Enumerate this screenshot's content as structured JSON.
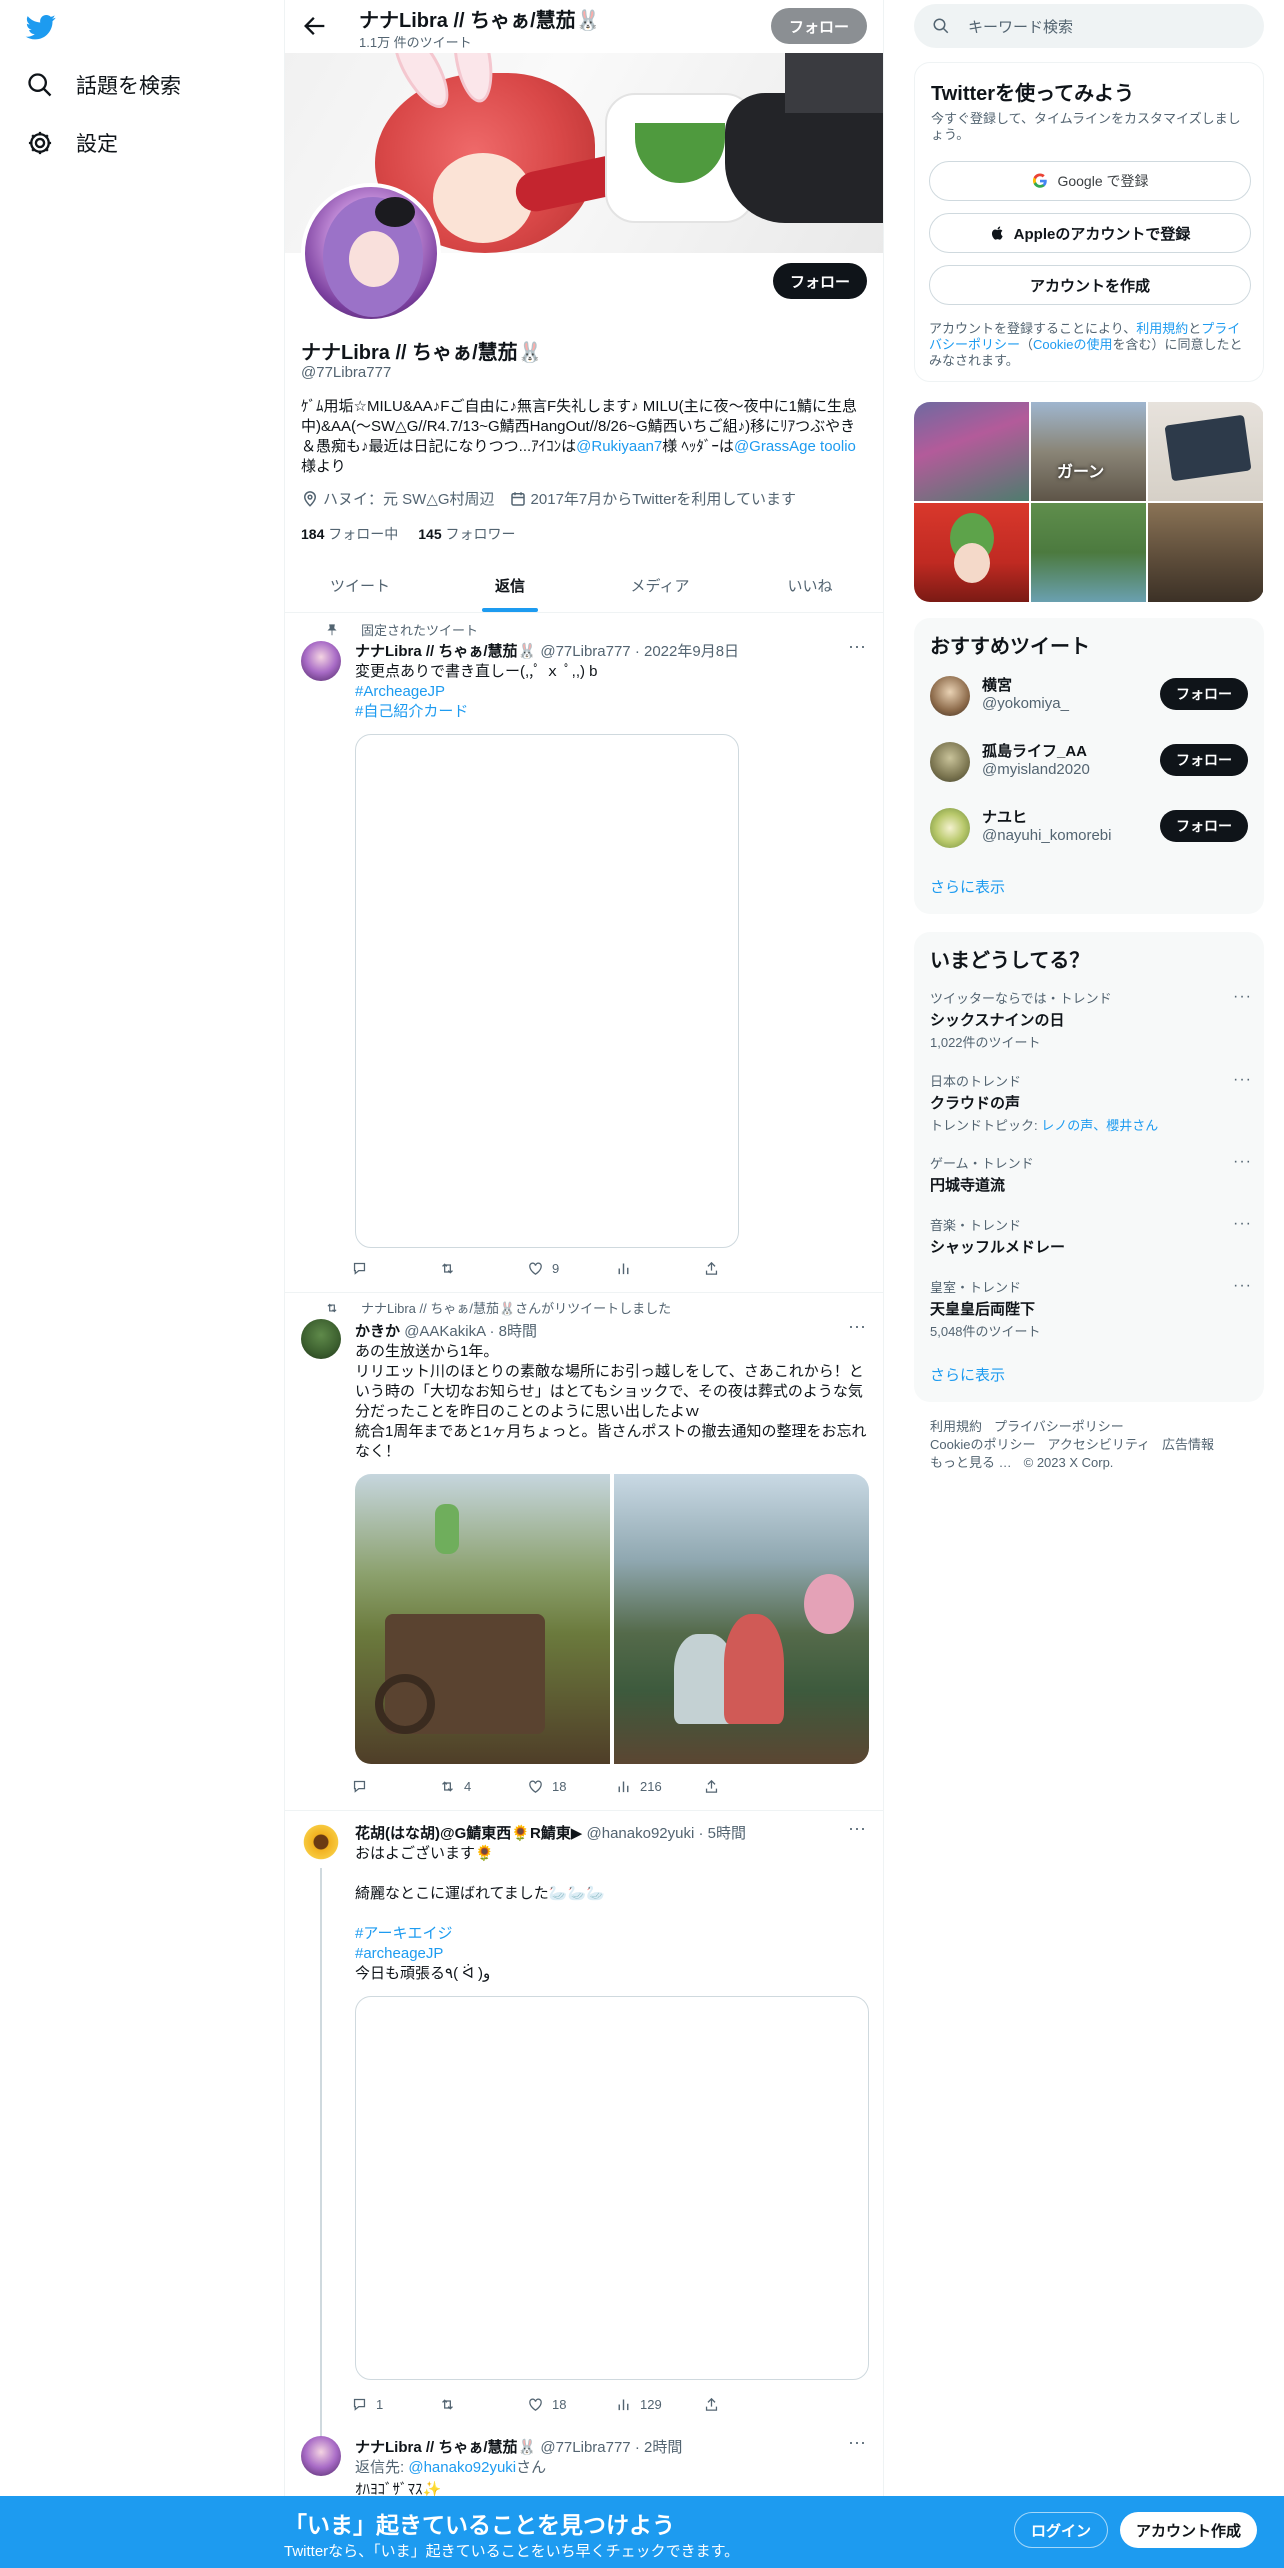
{
  "nav": {
    "explore_label": "話題を検索",
    "settings_label": "設定"
  },
  "header": {
    "name": "ナナLibra // ちゃぁ/慧茄🐰",
    "tweet_count": "1.1万 件のツイート",
    "follow_label": "フォロー"
  },
  "profile": {
    "follow_label": "フォロー",
    "name": "ナナLibra // ちゃぁ/慧茄🐰",
    "handle": "@77Libra777",
    "bio_text": "ｹﾞﾑ用垢☆MILU&AA♪Fご自由に♪無言F失礼します♪ MILU(主に夜〜夜中に1鯖に生息中)&AA(〜SW△G//R4.7/13~G鯖西HangOut//8/26~G鯖西いちご組♪)移にﾘｱつぶやき＆愚痴も♪最近は日記になりつつ...ｱｲｺﾝは",
    "bio_link1": "@Rukiyaan7",
    "bio_mid": "様 ﾍｯﾀﾞｰは",
    "bio_link2": "@GrassAge toolio",
    "bio_end": "様より",
    "location": "ハヌイ：元 SW△G村周辺",
    "joined": "2017年7月からTwitterを利用しています",
    "following_count": "184",
    "following_label": "フォロー中",
    "followers_count": "145",
    "followers_label": "フォロワー"
  },
  "tabs": [
    {
      "label": "ツイート"
    },
    {
      "label": "返信"
    },
    {
      "label": "メディア"
    },
    {
      "label": "いいね"
    }
  ],
  "tweets": [
    {
      "context": "固定されたツイート",
      "name": "ナナLibra // ちゃぁ/慧茄🐰",
      "handle": "@77Libra777",
      "time": "2022年9月8日",
      "text": "変更点ありで書き直しー(,,ﾟ ｘ ﾟ,,) b",
      "tag1": "#ArcheageJP",
      "tag2": "#自己紹介カード",
      "likes": "9"
    },
    {
      "context": "ナナLibra // ちゃぁ/慧茄🐰さんがリツイートしました",
      "name": "かきか",
      "handle": "@AAKakikA",
      "time": "8時間",
      "text": "あの生放送から1年。\nリリエット川のほとりの素敵な場所にお引っ越しをして、さあこれから！という時の「大切なお知らせ」はとてもショックで、その夜は葬式のような気分だったことを昨日のことのように思い出したよｗ\n統合1周年まであと1ヶ月ちょっと。皆さんポストの撤去通知の整理をお忘れなく！",
      "retweets": "4",
      "likes": "18",
      "views": "216"
    },
    {
      "name": "花胡(はな胡)@G鯖東西🌻R鯖東▶",
      "handle": "@hanako92yuki",
      "time": "5時間",
      "line1": "おはよございます🌻",
      "line2": "綺麗なとこに運ばれてました🦢🦢🦢",
      "tag1": "#アーキエイジ",
      "tag2": "#archeageJP",
      "line3": "今日も頑張る٩( ᐛ )و",
      "replies": "1",
      "likes": "18",
      "views": "129"
    },
    {
      "name": "ナナLibra // ちゃぁ/慧茄🐰",
      "handle": "@77Libra777",
      "time": "2時間",
      "reply_prefix": "返信先:",
      "reply_to": "@hanako92yuki",
      "reply_suffix": "さん",
      "text": "ｵﾊﾖｺﾞｻﾞﾏｽ✨"
    }
  ],
  "search": {
    "placeholder": "キーワード検索"
  },
  "signup": {
    "title": "Twitterを使ってみよう",
    "subtitle": "今すぐ登録して、タイムラインをカスタマイズしましょう。",
    "google": "Google で登録",
    "apple": "Appleのアカウントで登録",
    "create": "アカウントを作成",
    "legal_a": "アカウントを登録することにより、",
    "legal_terms": "利用規約",
    "legal_and": "と",
    "legal_privacy": "プライバシーポリシー",
    "legal_b": "（",
    "legal_cookie": "Cookieの使用",
    "legal_c": "を含む）に同意したとみなされます。"
  },
  "grid_caption": "ガーン",
  "recommend": {
    "title": "おすすめツイート",
    "users": [
      {
        "name": "横宮",
        "handle": "@yokomiya_",
        "btn": "フォロー"
      },
      {
        "name": "孤島ライフ_AA",
        "handle": "@myisland2020",
        "btn": "フォロー"
      },
      {
        "name": "ナユヒ",
        "handle": "@nayuhi_komorebi",
        "btn": "フォロー"
      }
    ],
    "more": "さらに表示"
  },
  "trends": {
    "title": "いまどうしてる？",
    "items": [
      {
        "cat": "ツイッターならでは・トレンド",
        "name": "シックスナインの日",
        "sub": "1,022件のツイート"
      },
      {
        "cat": "日本のトレンド",
        "name": "クラウドの声",
        "sub_prefix": "トレンドトピック: ",
        "sub_link": "レノの声、櫻井さん"
      },
      {
        "cat": "ゲーム・トレンド",
        "name": "円城寺道流"
      },
      {
        "cat": "音楽・トレンド",
        "name": "シャッフルメドレー"
      },
      {
        "cat": "皇室・トレンド",
        "name": "天皇皇后両陛下",
        "sub": "5,048件のツイート"
      }
    ],
    "more": "さらに表示"
  },
  "footer": {
    "terms": "利用規約",
    "privacy": "プライバシーポリシー",
    "cookie": "Cookieのポリシー",
    "accessibility": "アクセシビリティ",
    "ads": "広告情報",
    "more": "もっと見る …",
    "copyright": "© 2023 X Corp."
  },
  "bottom": {
    "title": "「いま」起きていることを見つけよう",
    "subtitle": "Twitterなら、「いま」起きていることをいち早くチェックできます。",
    "login": "ログイン",
    "signup": "アカウント作成"
  },
  "colors": {
    "accent": "#1d9bf0",
    "text": "#0f1419",
    "muted": "#536471"
  }
}
